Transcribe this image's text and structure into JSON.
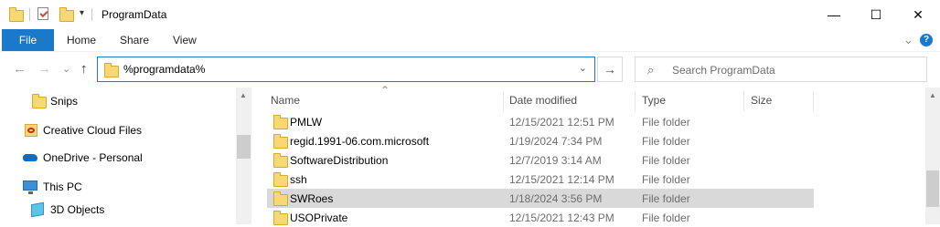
{
  "window": {
    "title": "ProgramData",
    "minimize": "—",
    "maximize": "☐",
    "close": "✕"
  },
  "ribbon": {
    "tabs": [
      "File",
      "Home",
      "Share",
      "View"
    ],
    "expand_icon": "⌄",
    "help_icon": "?"
  },
  "address": {
    "back": "←",
    "forward": "→",
    "recent": "⌄",
    "up": "↑",
    "path": "%programdata%",
    "dropdown": "⌄",
    "go": "→"
  },
  "search": {
    "placeholder": "Search ProgramData",
    "icon": "⌕"
  },
  "nav_pane": {
    "items": [
      {
        "label": "Snips",
        "icon": "folder-icon"
      },
      {
        "label": "Creative Cloud Files",
        "icon": "creative-cloud-icon"
      },
      {
        "label": "OneDrive - Personal",
        "icon": "cloud-icon"
      },
      {
        "label": "This PC",
        "icon": "pc-icon"
      },
      {
        "label": "3D Objects",
        "icon": "cube-icon"
      }
    ]
  },
  "columns": {
    "name": "Name",
    "date": "Date modified",
    "type": "Type",
    "size": "Size",
    "sort_indicator": "⌃"
  },
  "files": [
    {
      "name": "PMLW",
      "date": "12/15/2021 12:51 PM",
      "type": "File folder",
      "selected": false
    },
    {
      "name": "regid.1991-06.com.microsoft",
      "date": "1/19/2024 7:34 PM",
      "type": "File folder",
      "selected": false
    },
    {
      "name": "SoftwareDistribution",
      "date": "12/7/2019 3:14 AM",
      "type": "File folder",
      "selected": false
    },
    {
      "name": "ssh",
      "date": "12/15/2021 12:14 PM",
      "type": "File folder",
      "selected": false
    },
    {
      "name": "SWRoes",
      "date": "1/18/2024 3:56 PM",
      "type": "File folder",
      "selected": true
    },
    {
      "name": "USOPrivate",
      "date": "12/15/2021 12:43 PM",
      "type": "File folder",
      "selected": false
    }
  ]
}
